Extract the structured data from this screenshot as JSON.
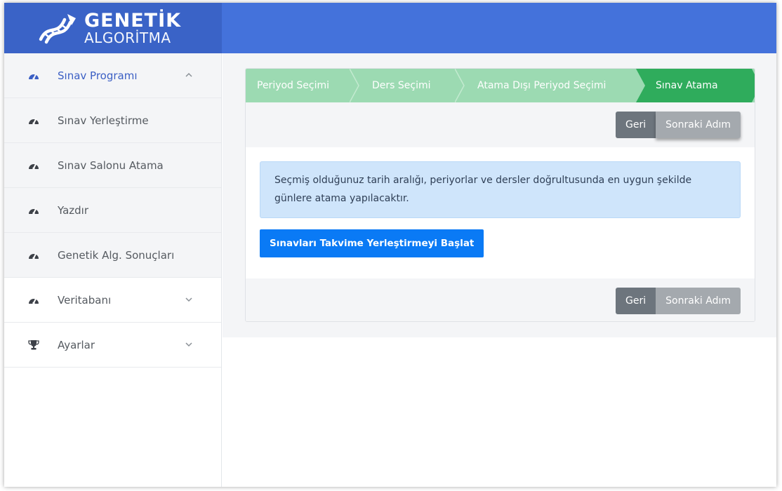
{
  "header": {
    "logo_line1": "GENETİK",
    "logo_line2": "ALGORİTMA"
  },
  "sidebar": {
    "items": [
      {
        "label": "Sınav Programı",
        "icon": "dashboard-icon",
        "state": "expanded"
      },
      {
        "label": "Sınav Yerleştirme",
        "icon": "dashboard-icon"
      },
      {
        "label": "Sınav Salonu Atama",
        "icon": "dashboard-icon"
      },
      {
        "label": "Yazdır",
        "icon": "dashboard-icon"
      },
      {
        "label": "Genetik Alg. Sonuçları",
        "icon": "dashboard-icon"
      },
      {
        "label": "Veritabanı",
        "icon": "dashboard-icon",
        "state": "collapsed"
      },
      {
        "label": "Ayarlar",
        "icon": "trophy-icon",
        "state": "collapsed"
      }
    ]
  },
  "wizard": {
    "steps": [
      "Periyod Seçimi",
      "Ders Seçimi",
      "Atama Dışı Periyod Seçimi",
      "Sınav Atama"
    ],
    "active_step": "Sınav Atama"
  },
  "actions": {
    "back_label": "Geri",
    "next_label": "Sonraki Adım"
  },
  "content": {
    "info_text": "Seçmiş olduğunuz tarih aralığı, periyorlar ve dersler doğrultusunda en uygun şekilde günlere atama yapılacaktır.",
    "start_button_label": "Sınavları Takvime Yerleştirmeyi Başlat"
  },
  "colors": {
    "header_logo_bg": "#3a63c7",
    "header_bar_bg": "#4472db",
    "step_inactive": "#9cdab2",
    "step_active": "#2fac5c",
    "primary_button": "#0a7af5",
    "info_bg": "#cfe5fb"
  }
}
